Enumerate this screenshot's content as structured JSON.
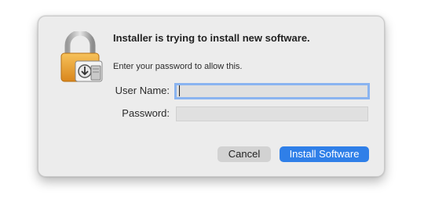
{
  "dialog": {
    "title": "Installer is trying to install new software.",
    "subtitle": "Enter your password to allow this.",
    "icon": "lock-with-installer-icon"
  },
  "form": {
    "username_label": "User Name:",
    "username_value": "",
    "password_label": "Password:",
    "password_value": ""
  },
  "buttons": {
    "cancel_label": "Cancel",
    "install_label": "Install Software"
  },
  "colors": {
    "accent": "#2f7fe8",
    "focus_ring": "#8ab4f0",
    "lock_gold": "#f0a93a"
  }
}
